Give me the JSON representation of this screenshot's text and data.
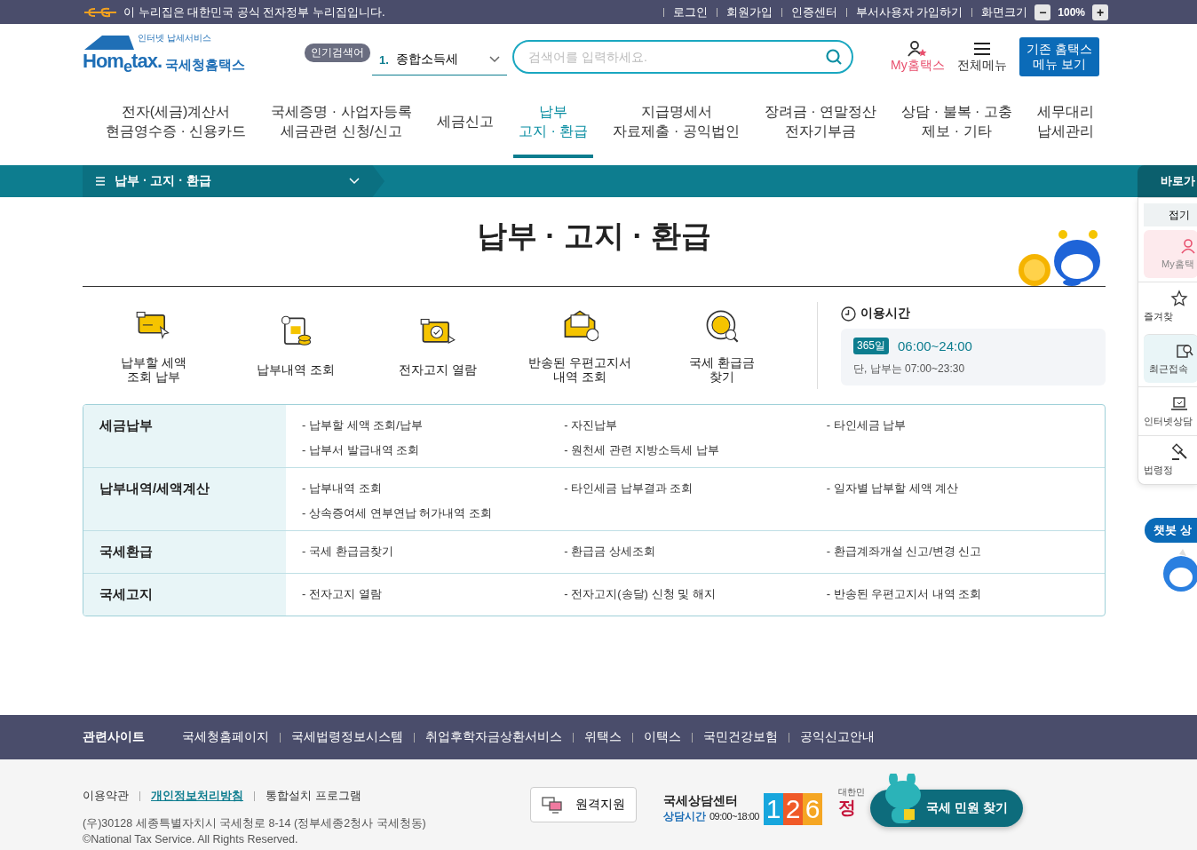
{
  "top_bar": {
    "notice": "이 누리집은 대한민국 공식 전자정부 누리집입니다.",
    "links": [
      "로그인",
      "회원가입",
      "인증센터",
      "부서사용자 가입하기"
    ],
    "zoom_label": "화면크기",
    "zoom_minus": "−",
    "zoom_value": "100%",
    "zoom_plus": "+"
  },
  "header": {
    "logo": {
      "tagline": "인터넷 납세서비스",
      "wordmark": "Hom$_{e}$tax.",
      "name": "국세청홈택스"
    },
    "popular_badge": "인기검색어",
    "popular": {
      "rank": "1.",
      "term": "종합소득세"
    },
    "search": {
      "placeholder": "검색어를 입력하세요."
    },
    "my_hometax": "My홈택스",
    "all_menu": "전체메뉴",
    "classic_button": "기존 홈택스\n메뉴 보기"
  },
  "nav": [
    {
      "label": "전자(세금)계산서\n현금영수증 · 신용카드",
      "selected": false
    },
    {
      "label": "국세증명 · 사업자등록\n세금관련 신청/신고",
      "selected": false
    },
    {
      "label": "세금신고",
      "selected": false
    },
    {
      "label": "납부\n고지 · 환급",
      "selected": true
    },
    {
      "label": "지급명세서\n자료제출 · 공익법인",
      "selected": false
    },
    {
      "label": "장려금 · 연말정산\n전자기부금",
      "selected": false
    },
    {
      "label": "상담 · 불복 · 고충\n제보 · 기타",
      "selected": false
    },
    {
      "label": "세무대리\n납세관리",
      "selected": false
    }
  ],
  "breadcrumb": "납부 · 고지 · 환급",
  "page_title": "납부 · 고지 · 환급",
  "services": [
    {
      "label": "납부할 세액\n조회 납부"
    },
    {
      "label": "납부내역 조회"
    },
    {
      "label": "전자고지 열람"
    },
    {
      "label": "반송된 우편고지서\n내역 조회"
    },
    {
      "label": "국세 환급금\n찾기"
    }
  ],
  "hours": {
    "title": "이용시간",
    "badge": "365일",
    "time": "06:00~24:00",
    "note": "단, 납부는 07:00~23:30"
  },
  "sections": [
    {
      "title": "세금납부",
      "links": [
        "- 납부할 세액 조회/납부",
        "- 자진납부",
        "- 타인세금 납부",
        "- 납부서 발급내역 조회",
        "- 원천세 관련 지방소득세 납부"
      ]
    },
    {
      "title": "납부내역/세액계산",
      "links": [
        "- 납부내역 조회",
        "- 타인세금 납부결과 조회",
        "- 일자별 납부할 세액 계산",
        "- 상속증여세 연부연납 허가내역 조회"
      ]
    },
    {
      "title": "국세환급",
      "links": [
        "- 국세 환급금찾기",
        "- 환급금 상세조회",
        "- 환급계좌개설 신고/변경 신고"
      ]
    },
    {
      "title": "국세고지",
      "links": [
        "- 전자고지 열람",
        "- 전자고지(송달) 신청 및 해지",
        "- 반송된 우편고지서 내역 조회"
      ]
    }
  ],
  "quick_panel": {
    "title": "바로가",
    "fold": "접기",
    "items": [
      {
        "kind": "user",
        "label": "My홈택"
      },
      {
        "kind": "star",
        "label": "즐겨찾"
      },
      {
        "kind": "recent",
        "label": "최근접속"
      },
      {
        "kind": "laptop",
        "label": "인터넷상담"
      },
      {
        "kind": "gavel",
        "label": "법령정"
      }
    ],
    "chatbot": "챗봇 상"
  },
  "related": {
    "title": "관련사이트",
    "links": [
      "국세청홈페이지",
      "국세법령정보시스템",
      "취업후학자금상환서비스",
      "위택스",
      "이택스",
      "국민건강보험",
      "공익신고안내"
    ]
  },
  "footer": {
    "links": [
      {
        "label": "이용약관",
        "highlighted": false
      },
      {
        "label": "개인정보처리방침",
        "highlighted": true
      },
      {
        "label": "통합설치 프로그램",
        "highlighted": false
      }
    ],
    "address": "(우)30128 세종특별자치시 국세청로 8-14 (정부세종2청사 국세청동)",
    "copyright": "©National Tax Service. All Rights Reserved.",
    "remote_button": "원격지원",
    "center_name": "국세상담센터",
    "hours_label": "상담시간",
    "hours": "09:00~18:00",
    "center_number": "126",
    "gov_small": "대한민",
    "gov_main": "정",
    "civil_button": "국세 민원 찾기"
  }
}
